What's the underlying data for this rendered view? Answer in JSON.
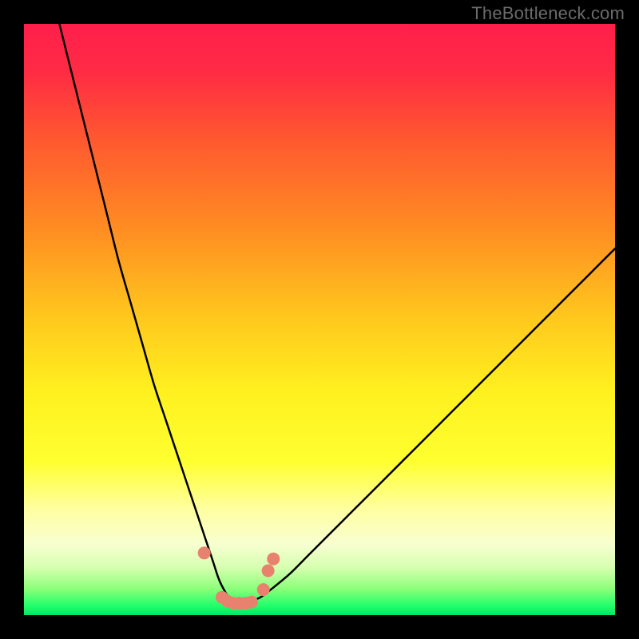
{
  "watermark": "TheBottleneck.com",
  "colors": {
    "frame": "#000000",
    "watermark": "#6b6b6b",
    "curve": "#000000",
    "marker_fill": "#e9816f",
    "marker_stroke": "#d55c4a",
    "gradient_stops": [
      {
        "offset": 0.0,
        "color": "#ff1f4b"
      },
      {
        "offset": 0.08,
        "color": "#ff2b44"
      },
      {
        "offset": 0.2,
        "color": "#ff5a2f"
      },
      {
        "offset": 0.35,
        "color": "#ff8e22"
      },
      {
        "offset": 0.5,
        "color": "#ffc91d"
      },
      {
        "offset": 0.62,
        "color": "#fff01f"
      },
      {
        "offset": 0.74,
        "color": "#ffff30"
      },
      {
        "offset": 0.82,
        "color": "#ffffa0"
      },
      {
        "offset": 0.88,
        "color": "#f7ffd0"
      },
      {
        "offset": 0.92,
        "color": "#d6ffb0"
      },
      {
        "offset": 0.955,
        "color": "#8dff7a"
      },
      {
        "offset": 0.985,
        "color": "#1fff6b"
      },
      {
        "offset": 1.0,
        "color": "#00e765"
      }
    ]
  },
  "chart_data": {
    "type": "line",
    "title": "",
    "xlabel": "",
    "ylabel": "",
    "xlim": [
      0,
      100
    ],
    "ylim": [
      0,
      100
    ],
    "grid": false,
    "legend": false,
    "series": [
      {
        "name": "bottleneck-curve",
        "x": [
          6,
          8,
          10,
          12,
          14,
          16,
          18,
          20,
          22,
          24,
          26,
          27,
          28,
          29,
          30,
          31,
          32,
          33,
          34,
          35,
          36,
          37,
          38,
          40,
          42,
          45,
          48,
          52,
          56,
          60,
          65,
          70,
          75,
          80,
          85,
          90,
          95,
          100
        ],
        "y": [
          100,
          92,
          84,
          76,
          68,
          60,
          53,
          46,
          39,
          33,
          27,
          24,
          21,
          18,
          15,
          12,
          9,
          6,
          4,
          2.5,
          2,
          2,
          2.2,
          3,
          4.5,
          7,
          10,
          14,
          18,
          22,
          27,
          32,
          37,
          42,
          47,
          52,
          57,
          62
        ]
      }
    ],
    "markers": {
      "name": "highlighted-points",
      "x": [
        30.5,
        33.5,
        34.5,
        35.5,
        36.5,
        37.5,
        38.5,
        40.5,
        41.3,
        42.2
      ],
      "y": [
        10.5,
        3.0,
        2.3,
        2.0,
        2.0,
        2.0,
        2.2,
        4.3,
        7.5,
        9.5
      ]
    }
  }
}
